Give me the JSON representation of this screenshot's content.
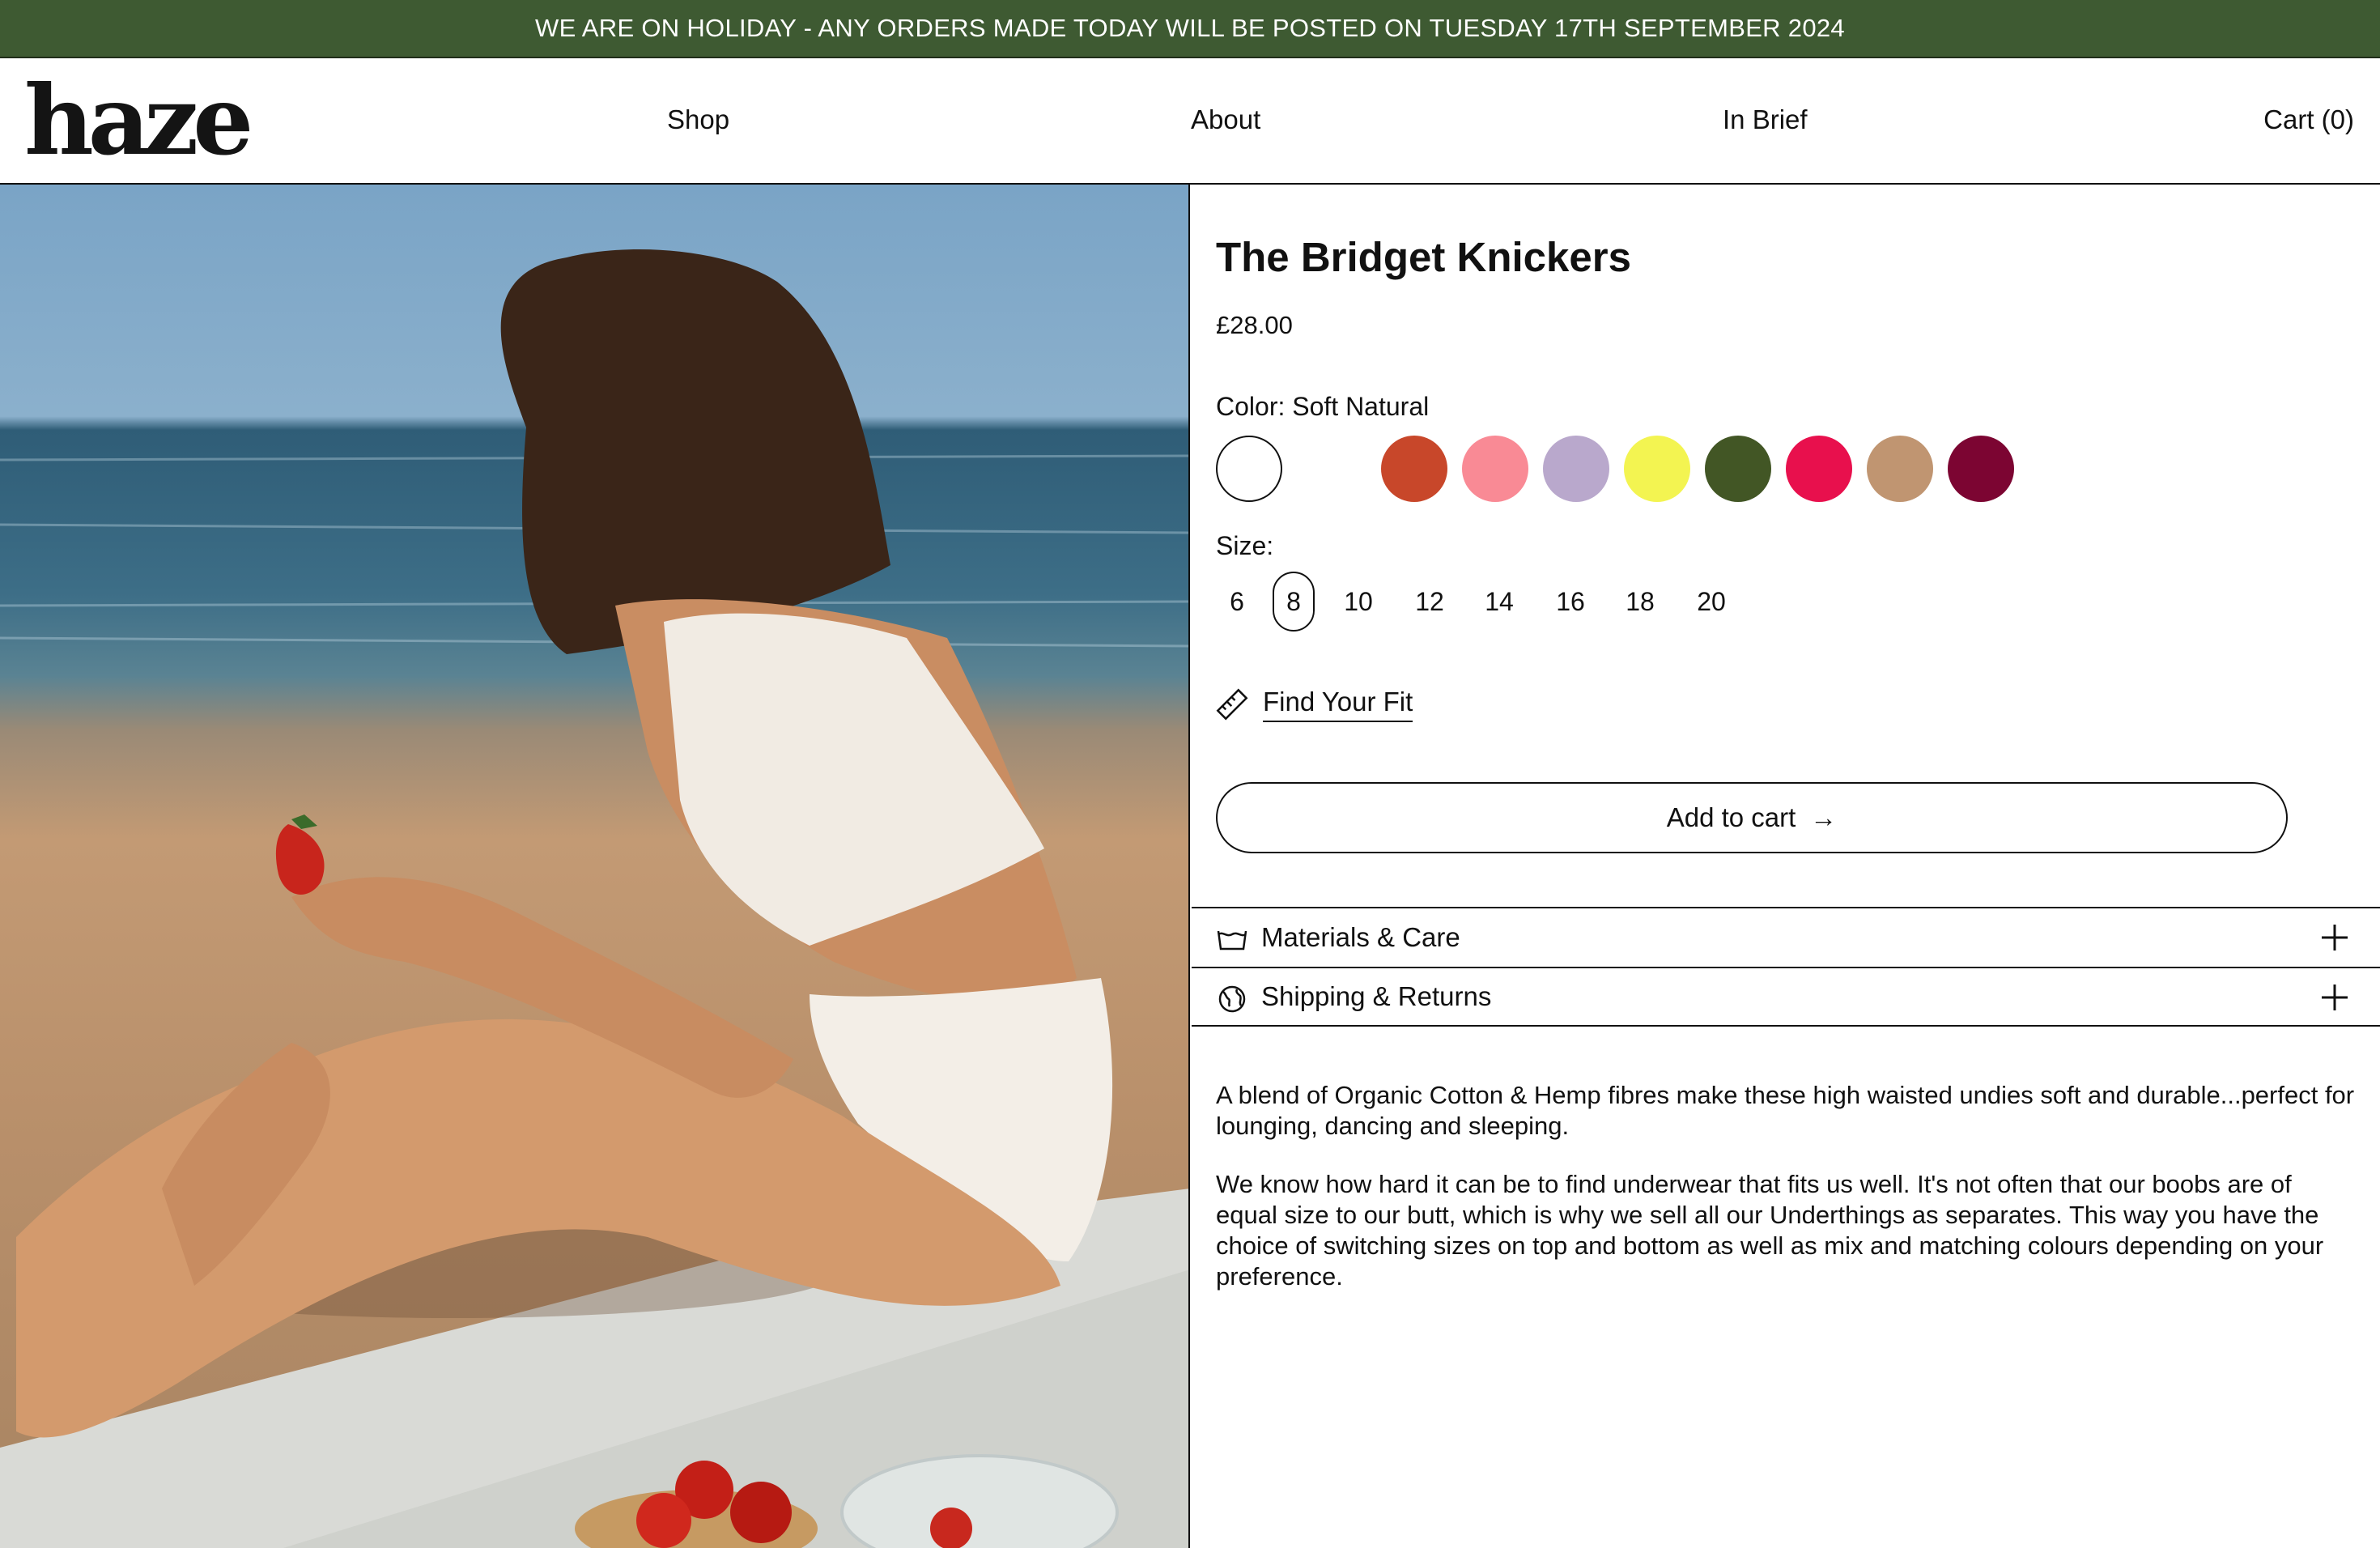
{
  "banner": {
    "text": "WE ARE ON HOLIDAY - ANY ORDERS MADE TODAY WILL BE POSTED ON TUESDAY 17TH SEPTEMBER 2024",
    "bg": "#3e5a32"
  },
  "header": {
    "logo": "haze",
    "nav": {
      "shop": "Shop",
      "about": "About",
      "in_brief": "In Brief",
      "cart": "Cart (0)"
    }
  },
  "product": {
    "title": "The Bridget Knickers",
    "price": "£28.00",
    "color_label": "Color: Soft Natural",
    "colors": [
      "#ffffff",
      "#ffffff",
      "#c8472a",
      "#f98a95",
      "#b9a8cc",
      "#f3f451",
      "#425625",
      "#e8104d",
      "#c09571",
      "#7c0532"
    ],
    "selected_color_index": 0,
    "size_label": "Size:",
    "sizes": [
      "6",
      "8",
      "10",
      "12",
      "14",
      "16",
      "18",
      "20"
    ],
    "selected_size": "8",
    "find_fit": "Find Your Fit",
    "add_to_cart": "Add to cart",
    "add_to_cart_arrow": "→"
  },
  "accordions": {
    "materials": "Materials & Care",
    "shipping": "Shipping & Returns"
  },
  "description": {
    "p1": "A blend of Organic Cotton & Hemp fibres make these high waisted undies soft and durable...perfect for lounging, dancing and sleeping.",
    "p2": "We know how hard it can be to find underwear that fits us well. It's not often that our boobs are of equal size to our butt, which is why we sell all our Underthings as separates. This way you have the choice of switching sizes on top and bottom as well as mix and matching colours depending on your preference."
  }
}
